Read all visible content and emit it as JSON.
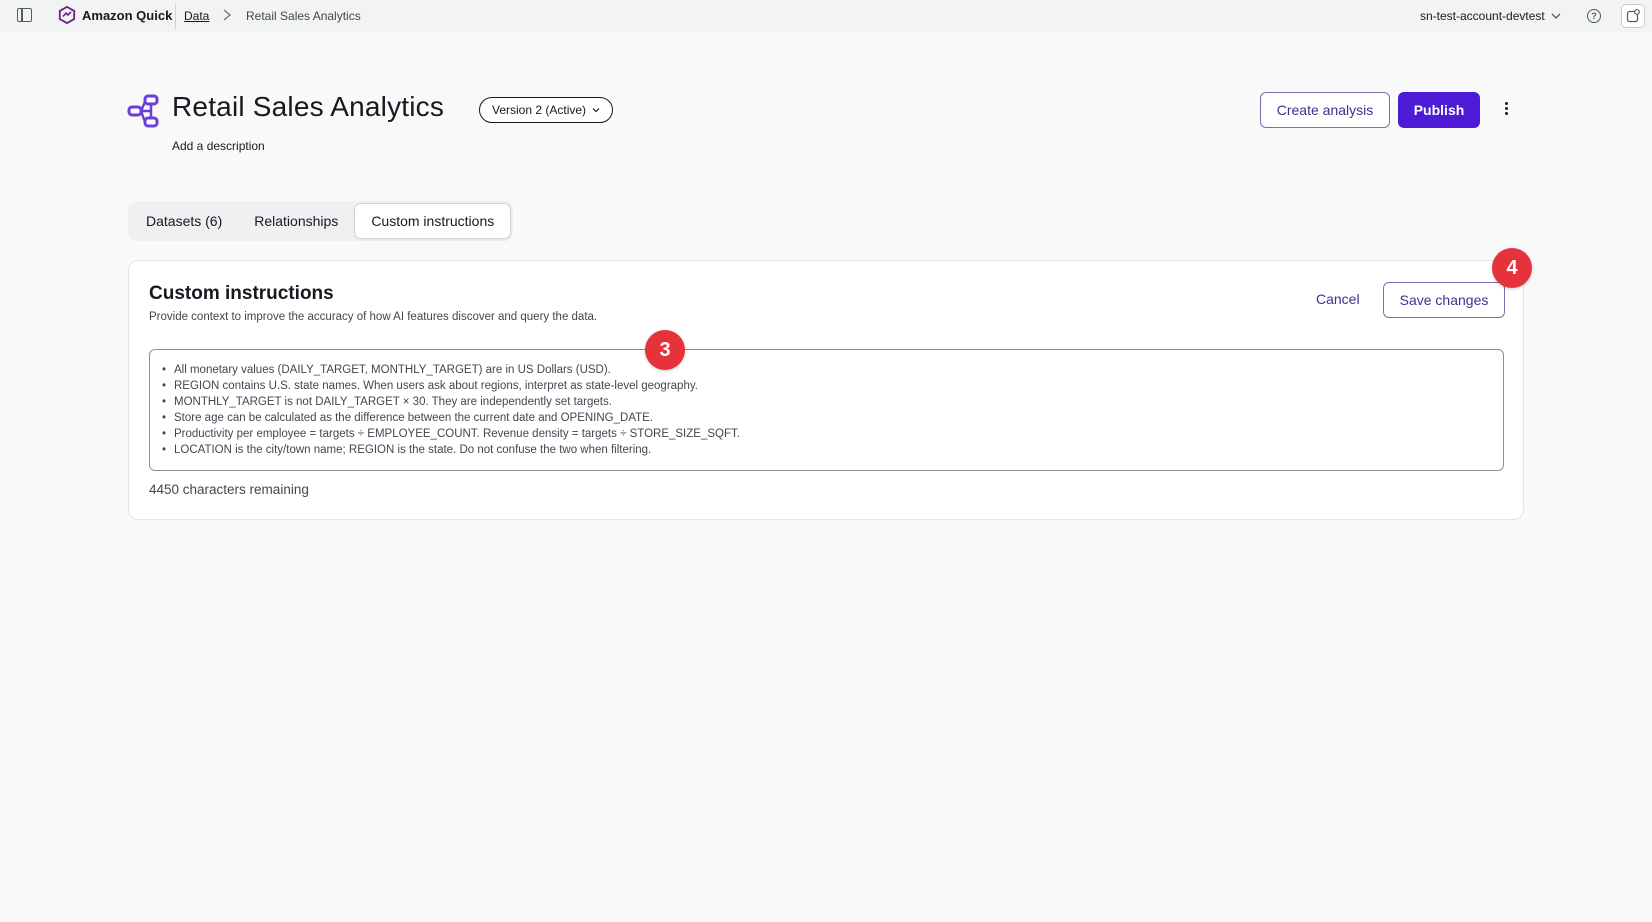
{
  "topbar": {
    "brand": "Amazon Quick",
    "breadcrumb_link": "Data",
    "breadcrumb_current": "Retail Sales Analytics",
    "account": "sn-test-account-devtest",
    "help_glyph": "?"
  },
  "header": {
    "title": "Retail Sales Analytics",
    "version": "Version 2 (Active)",
    "add_description": "Add a description",
    "create_analysis": "Create analysis",
    "publish": "Publish"
  },
  "tabs": [
    {
      "label": "Datasets (6)"
    },
    {
      "label": "Relationships"
    },
    {
      "label": "Custom instructions"
    }
  ],
  "card": {
    "title": "Custom instructions",
    "subtitle": "Provide context to improve the accuracy of how AI features discover and query the data.",
    "cancel": "Cancel",
    "save": "Save changes",
    "instructions": [
      "All monetary values (DAILY_TARGET, MONTHLY_TARGET) are in US Dollars (USD).",
      "REGION contains U.S. state names. When users ask about regions, interpret as state-level geography.",
      "MONTHLY_TARGET is not DAILY_TARGET × 30. They are independently set targets.",
      "Store age can be calculated as the difference between the current date and OPENING_DATE.",
      "Productivity per employee = targets ÷ EMPLOYEE_COUNT. Revenue density = targets ÷ STORE_SIZE_SQFT.",
      "LOCATION is the city/town name; REGION is the state. Do not confuse the two when filtering."
    ],
    "remaining": "4450 characters remaining"
  },
  "steps": {
    "three": "3",
    "four": "4"
  },
  "colors": {
    "primary": "#4d1bd6",
    "step_marker": "#e5323b",
    "link": "#4a2b8f"
  }
}
